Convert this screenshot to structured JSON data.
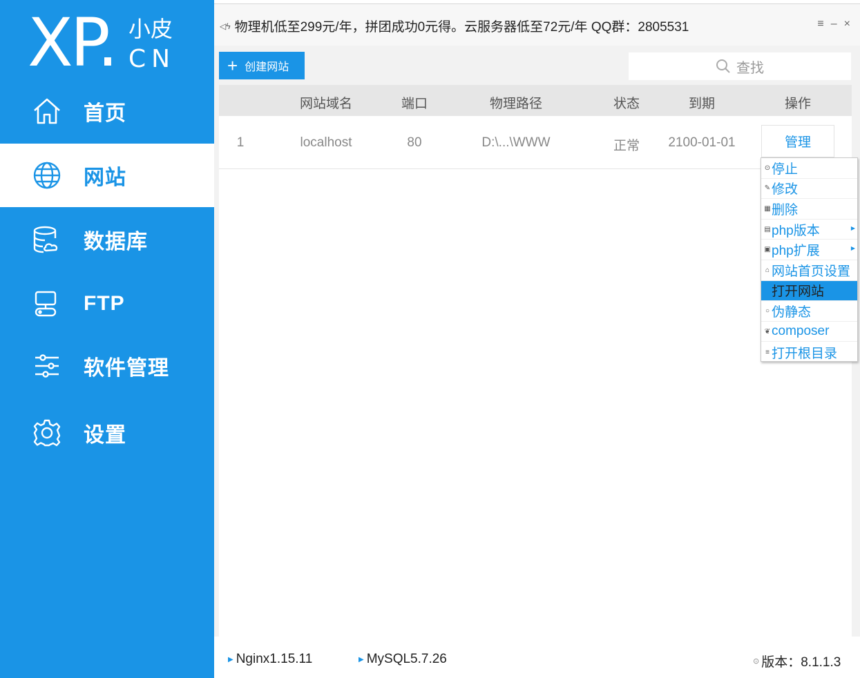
{
  "sidebar": {
    "logo": {
      "main": "XP.",
      "sub": "小皮",
      "cn": "CN"
    },
    "items": [
      {
        "label": "首页",
        "icon": "home-icon"
      },
      {
        "label": "网站",
        "icon": "globe-icon",
        "active": true
      },
      {
        "label": "数据库",
        "icon": "database-icon"
      },
      {
        "label": "FTP",
        "icon": "ftp-icon"
      },
      {
        "label": "软件管理",
        "icon": "sliders-icon"
      },
      {
        "label": "设置",
        "icon": "gear-icon"
      }
    ]
  },
  "topbar": {
    "notice": "物理机低至299元/年，拼团成功0元得。云服务器低至72元/年  QQ群：2805531",
    "controls": [
      "≡",
      "–",
      "×"
    ]
  },
  "toolbar": {
    "create_label": "创建网站",
    "search_placeholder": "查找"
  },
  "table": {
    "headers": [
      "网站域名",
      "端口",
      "物理路径",
      "状态",
      "到期",
      "操作"
    ],
    "rows": [
      {
        "index": "1",
        "domain": "localhost",
        "port": "80",
        "path": "D:\\...\\WWW",
        "status": "正常",
        "expiry": "2100-01-01",
        "action": "管理"
      }
    ]
  },
  "menu": {
    "items": [
      {
        "label": "停止",
        "icon": "⊙"
      },
      {
        "label": "修改",
        "icon": "✎"
      },
      {
        "label": "删除",
        "icon": "▦"
      },
      {
        "label": "php版本",
        "icon": "▤",
        "submenu": true
      },
      {
        "label": "php扩展",
        "icon": "▣",
        "submenu": true
      },
      {
        "label": "网站首页设置",
        "icon": "⌂"
      },
      {
        "label": "打开网站",
        "icon": "▪",
        "highlight": true
      },
      {
        "label": "伪静态",
        "icon": "○"
      },
      {
        "label": "composer",
        "icon": "❦"
      },
      {
        "label": "打开根目录",
        "icon": "≡"
      }
    ]
  },
  "statusbar": {
    "nginx": "Nginx1.15.11",
    "mysql": "MySQL5.7.26",
    "version": "版本：8.1.1.3"
  },
  "colors": {
    "accent": "#1a94e6"
  }
}
